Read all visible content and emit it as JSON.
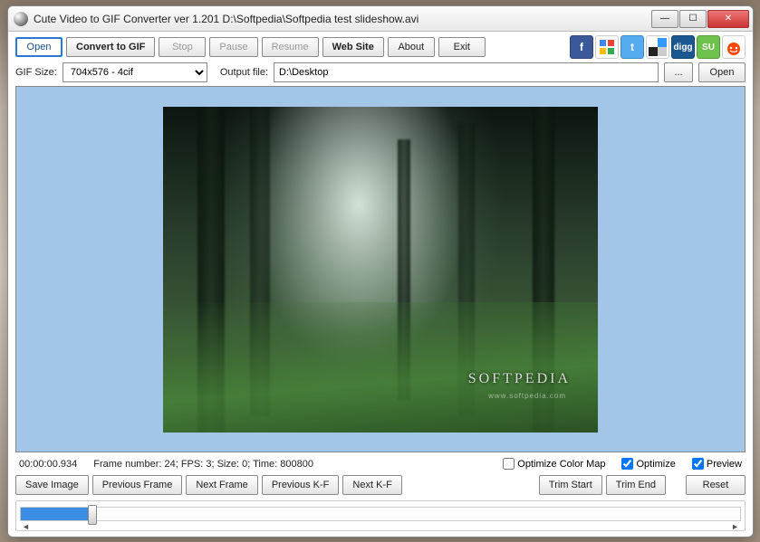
{
  "window": {
    "title": "Cute Video to GIF Converter ver 1.201  D:\\Softpedia\\Softpedia test slideshow.avi"
  },
  "toolbar": {
    "open": "Open",
    "convert": "Convert to GIF",
    "stop": "Stop",
    "pause": "Pause",
    "resume": "Resume",
    "website": "Web Site",
    "about": "About",
    "exit": "Exit"
  },
  "social": {
    "facebook": "f",
    "google": "g",
    "twitter": "t",
    "delicious": "",
    "digg": "digg",
    "stumble": "SU",
    "reddit": ""
  },
  "settings": {
    "gif_size_label": "GIF Size:",
    "gif_size_value": "704x576 - 4cif",
    "output_label": "Output file:",
    "output_value": "D:\\Desktop",
    "browse": "...",
    "open2": "Open"
  },
  "preview": {
    "watermark": "SOFTPEDIA",
    "watermark_sub": "www.softpedia.com"
  },
  "status": {
    "time": "00:00:00.934",
    "info": "Frame number: 24; FPS: 3; Size: 0; Time: 800800",
    "optimize_color_map": "Optimize Color Map",
    "optimize": "Optimize",
    "preview": "Preview"
  },
  "frame_buttons": {
    "save_image": "Save Image",
    "prev_frame": "Previous Frame",
    "next_frame": "Next Frame",
    "prev_kf": "Previous K-F",
    "next_kf": "Next K-F",
    "trim_start": "Trim Start",
    "trim_end": "Trim End",
    "reset": "Reset"
  }
}
